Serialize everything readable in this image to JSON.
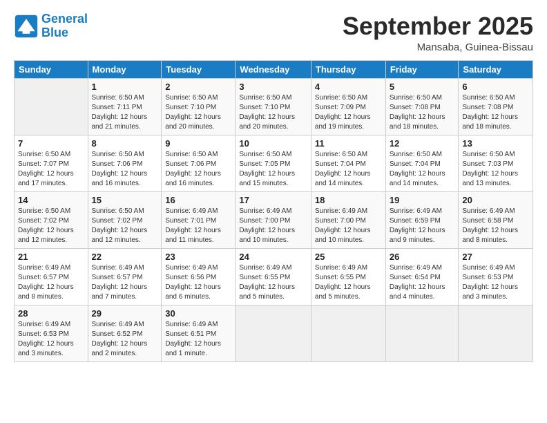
{
  "logo": {
    "line1": "General",
    "line2": "Blue"
  },
  "title": "September 2025",
  "subtitle": "Mansaba, Guinea-Bissau",
  "weekdays": [
    "Sunday",
    "Monday",
    "Tuesday",
    "Wednesday",
    "Thursday",
    "Friday",
    "Saturday"
  ],
  "weeks": [
    [
      {
        "day": "",
        "sunrise": "",
        "sunset": "",
        "daylight": ""
      },
      {
        "day": "1",
        "sunrise": "Sunrise: 6:50 AM",
        "sunset": "Sunset: 7:11 PM",
        "daylight": "Daylight: 12 hours and 21 minutes."
      },
      {
        "day": "2",
        "sunrise": "Sunrise: 6:50 AM",
        "sunset": "Sunset: 7:10 PM",
        "daylight": "Daylight: 12 hours and 20 minutes."
      },
      {
        "day": "3",
        "sunrise": "Sunrise: 6:50 AM",
        "sunset": "Sunset: 7:10 PM",
        "daylight": "Daylight: 12 hours and 20 minutes."
      },
      {
        "day": "4",
        "sunrise": "Sunrise: 6:50 AM",
        "sunset": "Sunset: 7:09 PM",
        "daylight": "Daylight: 12 hours and 19 minutes."
      },
      {
        "day": "5",
        "sunrise": "Sunrise: 6:50 AM",
        "sunset": "Sunset: 7:08 PM",
        "daylight": "Daylight: 12 hours and 18 minutes."
      },
      {
        "day": "6",
        "sunrise": "Sunrise: 6:50 AM",
        "sunset": "Sunset: 7:08 PM",
        "daylight": "Daylight: 12 hours and 18 minutes."
      }
    ],
    [
      {
        "day": "7",
        "sunrise": "Sunrise: 6:50 AM",
        "sunset": "Sunset: 7:07 PM",
        "daylight": "Daylight: 12 hours and 17 minutes."
      },
      {
        "day": "8",
        "sunrise": "Sunrise: 6:50 AM",
        "sunset": "Sunset: 7:06 PM",
        "daylight": "Daylight: 12 hours and 16 minutes."
      },
      {
        "day": "9",
        "sunrise": "Sunrise: 6:50 AM",
        "sunset": "Sunset: 7:06 PM",
        "daylight": "Daylight: 12 hours and 16 minutes."
      },
      {
        "day": "10",
        "sunrise": "Sunrise: 6:50 AM",
        "sunset": "Sunset: 7:05 PM",
        "daylight": "Daylight: 12 hours and 15 minutes."
      },
      {
        "day": "11",
        "sunrise": "Sunrise: 6:50 AM",
        "sunset": "Sunset: 7:04 PM",
        "daylight": "Daylight: 12 hours and 14 minutes."
      },
      {
        "day": "12",
        "sunrise": "Sunrise: 6:50 AM",
        "sunset": "Sunset: 7:04 PM",
        "daylight": "Daylight: 12 hours and 14 minutes."
      },
      {
        "day": "13",
        "sunrise": "Sunrise: 6:50 AM",
        "sunset": "Sunset: 7:03 PM",
        "daylight": "Daylight: 12 hours and 13 minutes."
      }
    ],
    [
      {
        "day": "14",
        "sunrise": "Sunrise: 6:50 AM",
        "sunset": "Sunset: 7:02 PM",
        "daylight": "Daylight: 12 hours and 12 minutes."
      },
      {
        "day": "15",
        "sunrise": "Sunrise: 6:50 AM",
        "sunset": "Sunset: 7:02 PM",
        "daylight": "Daylight: 12 hours and 12 minutes."
      },
      {
        "day": "16",
        "sunrise": "Sunrise: 6:49 AM",
        "sunset": "Sunset: 7:01 PM",
        "daylight": "Daylight: 12 hours and 11 minutes."
      },
      {
        "day": "17",
        "sunrise": "Sunrise: 6:49 AM",
        "sunset": "Sunset: 7:00 PM",
        "daylight": "Daylight: 12 hours and 10 minutes."
      },
      {
        "day": "18",
        "sunrise": "Sunrise: 6:49 AM",
        "sunset": "Sunset: 7:00 PM",
        "daylight": "Daylight: 12 hours and 10 minutes."
      },
      {
        "day": "19",
        "sunrise": "Sunrise: 6:49 AM",
        "sunset": "Sunset: 6:59 PM",
        "daylight": "Daylight: 12 hours and 9 minutes."
      },
      {
        "day": "20",
        "sunrise": "Sunrise: 6:49 AM",
        "sunset": "Sunset: 6:58 PM",
        "daylight": "Daylight: 12 hours and 8 minutes."
      }
    ],
    [
      {
        "day": "21",
        "sunrise": "Sunrise: 6:49 AM",
        "sunset": "Sunset: 6:57 PM",
        "daylight": "Daylight: 12 hours and 8 minutes."
      },
      {
        "day": "22",
        "sunrise": "Sunrise: 6:49 AM",
        "sunset": "Sunset: 6:57 PM",
        "daylight": "Daylight: 12 hours and 7 minutes."
      },
      {
        "day": "23",
        "sunrise": "Sunrise: 6:49 AM",
        "sunset": "Sunset: 6:56 PM",
        "daylight": "Daylight: 12 hours and 6 minutes."
      },
      {
        "day": "24",
        "sunrise": "Sunrise: 6:49 AM",
        "sunset": "Sunset: 6:55 PM",
        "daylight": "Daylight: 12 hours and 5 minutes."
      },
      {
        "day": "25",
        "sunrise": "Sunrise: 6:49 AM",
        "sunset": "Sunset: 6:55 PM",
        "daylight": "Daylight: 12 hours and 5 minutes."
      },
      {
        "day": "26",
        "sunrise": "Sunrise: 6:49 AM",
        "sunset": "Sunset: 6:54 PM",
        "daylight": "Daylight: 12 hours and 4 minutes."
      },
      {
        "day": "27",
        "sunrise": "Sunrise: 6:49 AM",
        "sunset": "Sunset: 6:53 PM",
        "daylight": "Daylight: 12 hours and 3 minutes."
      }
    ],
    [
      {
        "day": "28",
        "sunrise": "Sunrise: 6:49 AM",
        "sunset": "Sunset: 6:53 PM",
        "daylight": "Daylight: 12 hours and 3 minutes."
      },
      {
        "day": "29",
        "sunrise": "Sunrise: 6:49 AM",
        "sunset": "Sunset: 6:52 PM",
        "daylight": "Daylight: 12 hours and 2 minutes."
      },
      {
        "day": "30",
        "sunrise": "Sunrise: 6:49 AM",
        "sunset": "Sunset: 6:51 PM",
        "daylight": "Daylight: 12 hours and 1 minute."
      },
      {
        "day": "",
        "sunrise": "",
        "sunset": "",
        "daylight": ""
      },
      {
        "day": "",
        "sunrise": "",
        "sunset": "",
        "daylight": ""
      },
      {
        "day": "",
        "sunrise": "",
        "sunset": "",
        "daylight": ""
      },
      {
        "day": "",
        "sunrise": "",
        "sunset": "",
        "daylight": ""
      }
    ]
  ]
}
